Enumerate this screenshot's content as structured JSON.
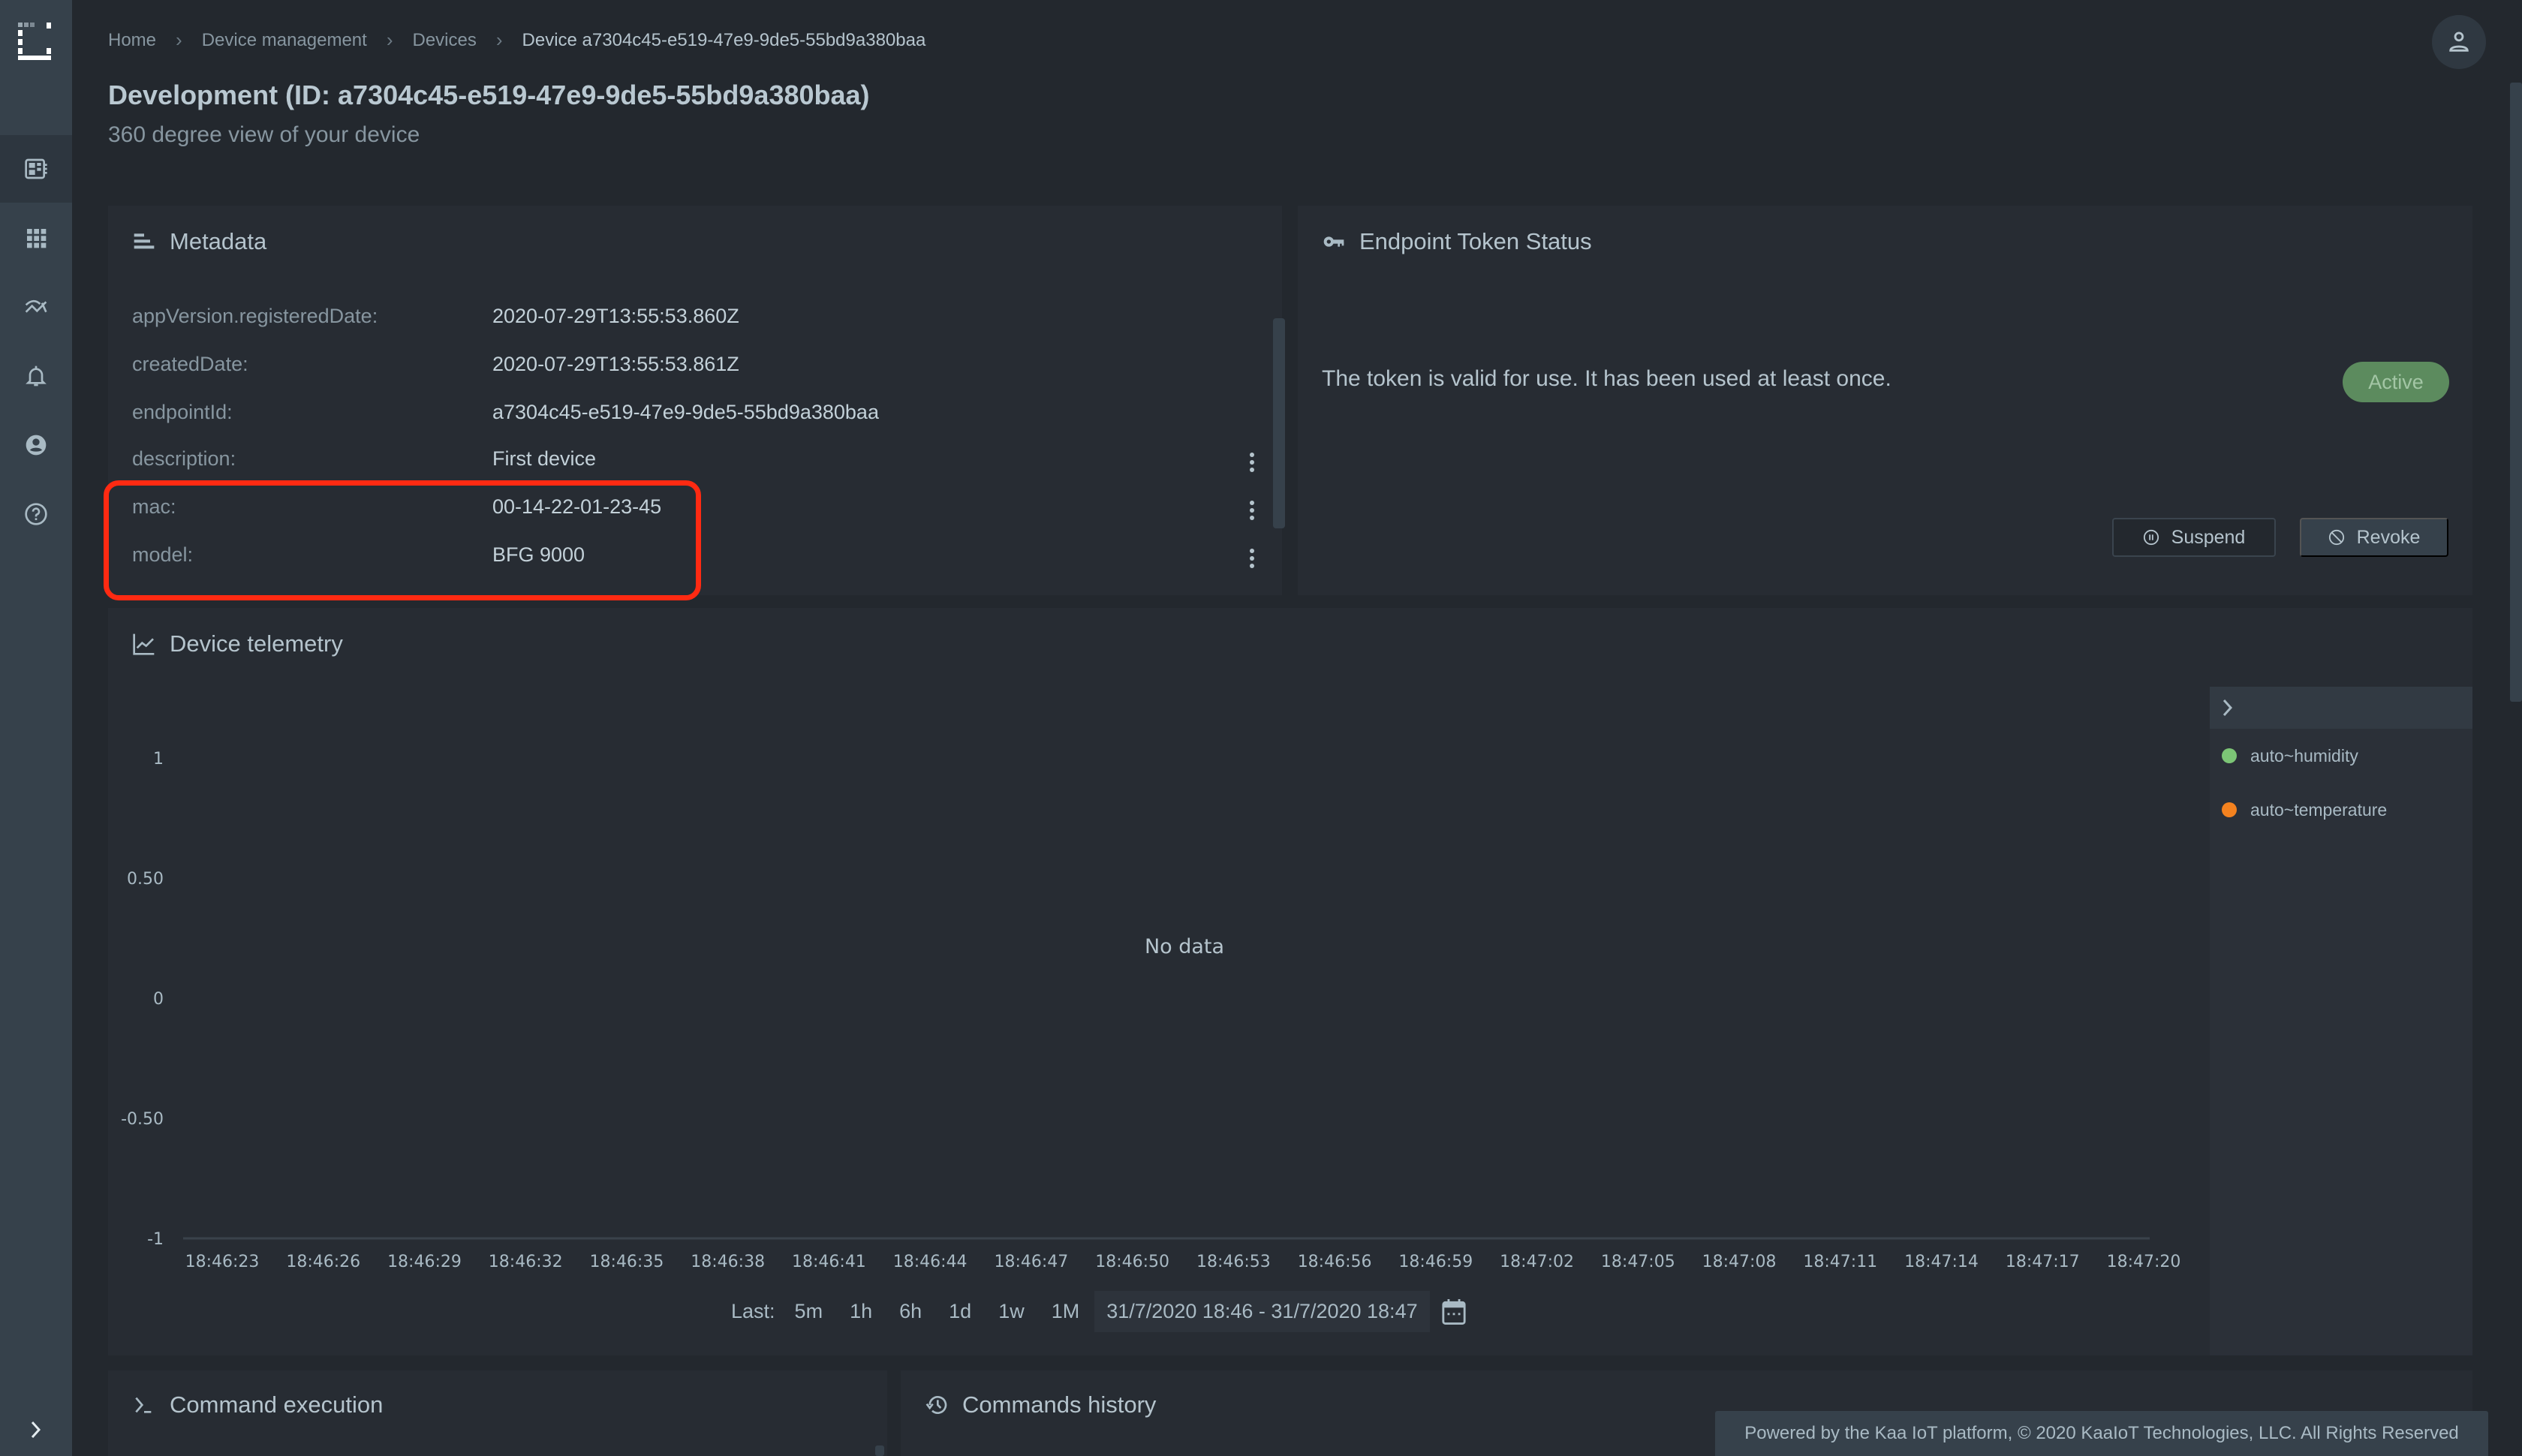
{
  "breadcrumb": {
    "items": [
      "Home",
      "Device management",
      "Devices"
    ],
    "current": "Device a7304c45-e519-47e9-9de5-55bd9a380baa"
  },
  "header": {
    "title": "Development (ID: a7304c45-e519-47e9-9de5-55bd9a380baa)",
    "subtitle": "360 degree view of your device"
  },
  "sidebar": {
    "items": [
      {
        "icon": "device-icon",
        "active": true
      },
      {
        "icon": "apps-grid-icon",
        "active": false
      },
      {
        "icon": "analytics-icon",
        "active": false
      },
      {
        "icon": "bell-icon",
        "active": false
      },
      {
        "icon": "account-circle-icon",
        "active": false
      },
      {
        "icon": "help-icon",
        "active": false
      }
    ],
    "toggle_icon": "chevron-right-icon"
  },
  "metadata": {
    "title": "Metadata",
    "rows": [
      {
        "key": "appVersion.registeredDate:",
        "value": "2020-07-29T13:55:53.860Z",
        "menu": false
      },
      {
        "key": "createdDate:",
        "value": "2020-07-29T13:55:53.861Z",
        "menu": false
      },
      {
        "key": "endpointId:",
        "value": "a7304c45-e519-47e9-9de5-55bd9a380baa",
        "menu": false
      },
      {
        "key": "description:",
        "value": "First device",
        "menu": true
      },
      {
        "key": "mac:",
        "value": "00-14-22-01-23-45",
        "menu": true
      },
      {
        "key": "model:",
        "value": "BFG 9000",
        "menu": true
      }
    ],
    "highlight_color": "#ff2a12"
  },
  "token": {
    "title": "Endpoint Token Status",
    "message": "The token is valid for use. It has been used at least once.",
    "status": "Active",
    "status_color": "#5c8b5e",
    "suspend_label": "Suspend",
    "revoke_label": "Revoke"
  },
  "telemetry": {
    "title": "Device telemetry",
    "no_data": "No data",
    "last_label": "Last:",
    "ranges": [
      "5m",
      "1h",
      "6h",
      "1d",
      "1w",
      "1M"
    ],
    "date_range": "31/7/2020 18:46 - 31/7/2020 18:47",
    "legend": [
      {
        "name": "auto~humidity",
        "color": "#7cc576"
      },
      {
        "name": "auto~temperature",
        "color": "#f4821f"
      }
    ]
  },
  "chart_data": {
    "type": "line",
    "title": "Device telemetry",
    "xlabel": "",
    "ylabel": "",
    "ylim": [
      -1,
      1
    ],
    "yticks": [
      "1",
      "0.50",
      "0",
      "-0.50",
      "-1"
    ],
    "x": [
      "18:46:23",
      "18:46:26",
      "18:46:29",
      "18:46:32",
      "18:46:35",
      "18:46:38",
      "18:46:41",
      "18:46:44",
      "18:46:47",
      "18:46:50",
      "18:46:53",
      "18:46:56",
      "18:46:59",
      "18:47:02",
      "18:47:05",
      "18:47:08",
      "18:47:11",
      "18:47:14",
      "18:47:17",
      "18:47:20"
    ],
    "series": [
      {
        "name": "auto~humidity",
        "values": []
      },
      {
        "name": "auto~temperature",
        "values": []
      }
    ],
    "grid": false,
    "legend": "right",
    "annotation": "No data"
  },
  "commands": {
    "execution_title": "Command execution",
    "history_title": "Commands history"
  },
  "footer": {
    "text": "Powered by the Kaa IoT platform, © 2020 KaaIoT Technologies, LLC. All Rights Reserved"
  }
}
